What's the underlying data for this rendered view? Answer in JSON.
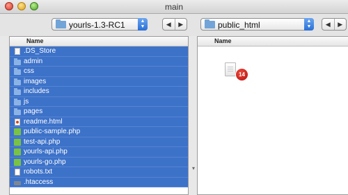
{
  "window": {
    "title": "main"
  },
  "left": {
    "folder": "yourls-1.3-RC1",
    "column_header": "Name",
    "files": [
      {
        "name": ".DS_Store",
        "icon": "document-icon"
      },
      {
        "name": "admin",
        "icon": "folder-icon"
      },
      {
        "name": "css",
        "icon": "folder-icon"
      },
      {
        "name": "images",
        "icon": "folder-icon"
      },
      {
        "name": "includes",
        "icon": "folder-icon"
      },
      {
        "name": "js",
        "icon": "folder-icon"
      },
      {
        "name": "pages",
        "icon": "folder-icon"
      },
      {
        "name": "readme.html",
        "icon": "html-file-icon"
      },
      {
        "name": "public-sample.php",
        "icon": "php-file-icon"
      },
      {
        "name": "test-api.php",
        "icon": "php-file-icon"
      },
      {
        "name": "yourls-api.php",
        "icon": "php-file-icon"
      },
      {
        "name": "yourls-go.php",
        "icon": "php-file-icon"
      },
      {
        "name": "robots.txt",
        "icon": "text-file-icon"
      },
      {
        "name": ".htaccess",
        "icon": "dark-file-icon"
      }
    ]
  },
  "right": {
    "folder": "public_html",
    "column_header": "Name",
    "badge_count": "14"
  },
  "nav": {
    "back": "◀",
    "forward": "▶"
  },
  "colors": {
    "selection": "#3d72c9",
    "badge": "#c8161b"
  }
}
